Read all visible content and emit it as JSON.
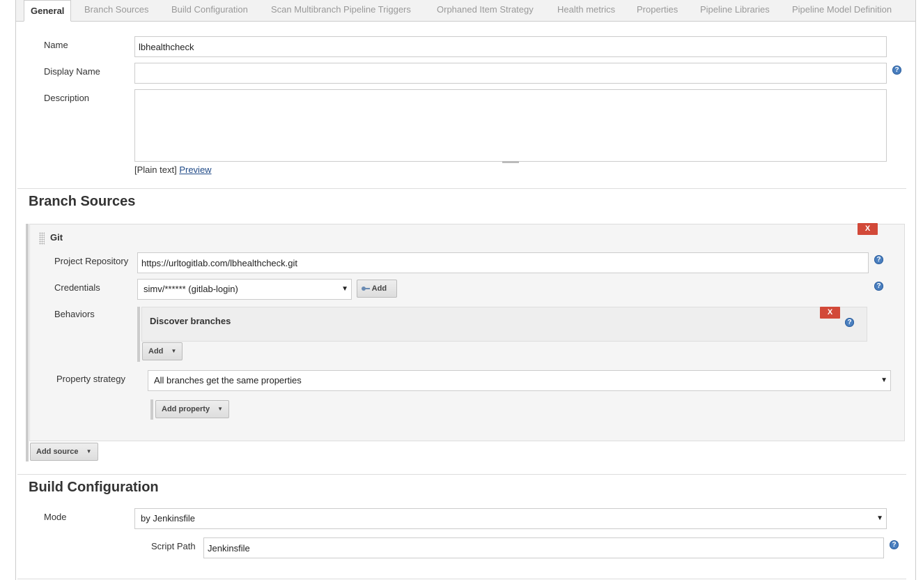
{
  "tabs": [
    {
      "label": "General"
    },
    {
      "label": "Branch Sources"
    },
    {
      "label": "Build Configuration"
    },
    {
      "label": "Scan Multibranch Pipeline Triggers"
    },
    {
      "label": "Orphaned Item Strategy"
    },
    {
      "label": "Health metrics"
    },
    {
      "label": "Properties"
    },
    {
      "label": "Pipeline Libraries"
    },
    {
      "label": "Pipeline Model Definition"
    }
  ],
  "general": {
    "name_label": "Name",
    "name_value": "lbhealthcheck",
    "display_name_label": "Display Name",
    "display_name_value": "",
    "description_label": "Description",
    "description_value": "",
    "plain_text": "[Plain text]",
    "preview_link": "Preview"
  },
  "branch_sources": {
    "title": "Branch Sources",
    "git": {
      "title": "Git",
      "delete_label": "X",
      "project_repository_label": "Project Repository",
      "project_repository_value": "https://urltogitlab.com/lbhealthcheck.git",
      "credentials_label": "Credentials",
      "credentials_value": "simv/****** (gitlab-login)",
      "credentials_add_label": "Add",
      "behaviors_label": "Behaviors",
      "behavior_title": "Discover branches",
      "behavior_delete_label": "X",
      "behaviors_add_label": "Add",
      "property_strategy_label": "Property strategy",
      "property_strategy_value": "All branches get the same properties",
      "add_property_label": "Add property"
    },
    "add_source_label": "Add source"
  },
  "build_configuration": {
    "title": "Build Configuration",
    "mode_label": "Mode",
    "mode_value": "by Jenkinsfile",
    "script_path_label": "Script Path",
    "script_path_value": "Jenkinsfile"
  },
  "icons": {
    "help": "?",
    "select_arrow": "▼",
    "caret": "▼",
    "key": "key-icon"
  }
}
